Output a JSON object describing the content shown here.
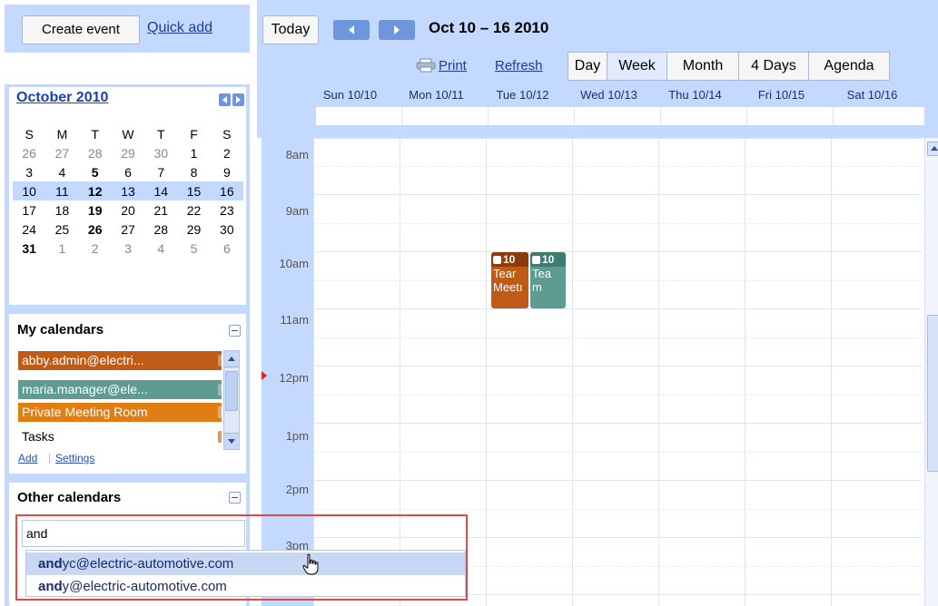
{
  "sidebar": {
    "create_event": "Create event",
    "quick_add": "Quick add",
    "mini_calendar": {
      "month_label": "October 2010",
      "day_initials": [
        "S",
        "M",
        "T",
        "W",
        "T",
        "F",
        "S"
      ],
      "weeks": [
        [
          "26",
          "27",
          "28",
          "29",
          "30",
          "1",
          "2"
        ],
        [
          "3",
          "4",
          "5",
          "6",
          "7",
          "8",
          "9"
        ],
        [
          "10",
          "11",
          "12",
          "13",
          "14",
          "15",
          "16"
        ],
        [
          "17",
          "18",
          "19",
          "20",
          "21",
          "22",
          "23"
        ],
        [
          "24",
          "25",
          "26",
          "27",
          "28",
          "29",
          "30"
        ],
        [
          "31",
          "1",
          "2",
          "3",
          "4",
          "5",
          "6"
        ]
      ],
      "selected_week_index": 2
    },
    "my_calendars": {
      "title": "My calendars",
      "items": [
        {
          "label": "abby.admin@electri...",
          "color": "#c05a17"
        },
        {
          "label": "maria.manager@ele...",
          "color": "#5e9b91"
        },
        {
          "label": "Private Meeting Room",
          "color": "#e07e13"
        },
        {
          "label": "Tasks",
          "color": "#ffffff"
        }
      ],
      "add_link": "Add",
      "settings_link": "Settings"
    },
    "other_calendars": {
      "title": "Other calendars",
      "search_value": "and",
      "suggestions": [
        {
          "match": "and",
          "rest": "yc@electric-automotive.com"
        },
        {
          "match": "and",
          "rest": "y@electric-automotive.com"
        }
      ]
    }
  },
  "toolbar": {
    "today": "Today",
    "date_range": "Oct 10 – 16 2010",
    "print": "Print",
    "refresh": "Refresh",
    "views": [
      "Day",
      "Week",
      "Month",
      "4 Days",
      "Agenda"
    ],
    "active_view": "Week"
  },
  "week": {
    "days": [
      "Sun 10/10",
      "Mon 10/11",
      "Tue 10/12",
      "Wed 10/13",
      "Thu 10/14",
      "Fri 10/15",
      "Sat 10/16"
    ],
    "hours": [
      "8am",
      "9am",
      "10am",
      "11am",
      "12pm",
      "1pm",
      "2pm",
      "3pm"
    ]
  },
  "events": [
    {
      "time": "10",
      "title": "Team Meeting",
      "day": "Tue 10/12",
      "color": "#c05a17",
      "shown_lines": [
        "Tear",
        "Meetı"
      ]
    },
    {
      "time": "10",
      "title": "Team",
      "day": "Tue 10/12",
      "color": "#5e9b91",
      "shown_lines": [
        "Tea",
        "m"
      ]
    }
  ]
}
